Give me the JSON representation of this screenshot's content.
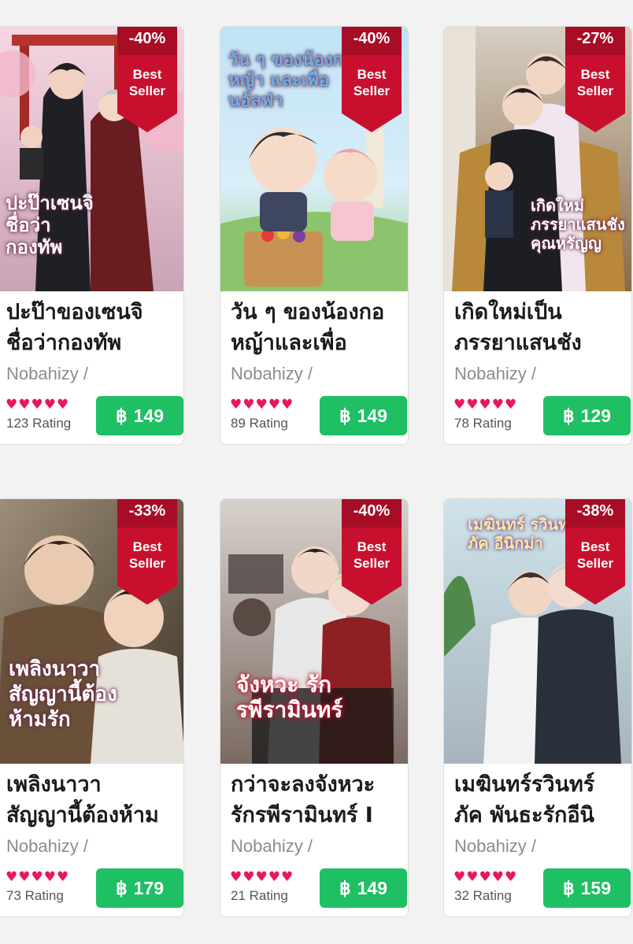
{
  "products": [
    {
      "title": "ปะป๊าของเซนจิ ชื่อว่ากองทัพ",
      "title_line1": "ปะป๊าของเซนจิ",
      "title_line2": "ชื่อว่ากองทัพ",
      "author": "Nobahizy /",
      "discount": "-40%",
      "badge": "Best Seller",
      "badge_line1": "Best",
      "badge_line2": "Seller",
      "hearts": 5,
      "rating": "123 Rating",
      "currency": "฿",
      "price": "149",
      "cover_text": "ปะป๊าเซนจิ ชื่อว่า กองทัพ"
    },
    {
      "title": "วัน ๆ ของน้องกอหญ้าและเพื่อ",
      "title_line1": "วัน ๆ ของน้องกอ",
      "title_line2": "หญ้าและเพื่อ",
      "author": "Nobahizy /",
      "discount": "-40%",
      "badge": "Best Seller",
      "badge_line1": "Best",
      "badge_line2": "Seller",
      "hearts": 5,
      "rating": "89 Rating",
      "currency": "฿",
      "price": "149",
      "cover_text": "วัน ๆ ของน้องกอหญ้า และเพื่อนอัลฟ่า"
    },
    {
      "title": "เกิดใหม่เป็นภรรยาแสนชัง",
      "title_line1": "เกิดใหม่เป็น",
      "title_line2": "ภรรยาแสนชัง",
      "author": "Nobahizy /",
      "discount": "-27%",
      "badge": "Best Seller",
      "badge_line1": "Best",
      "badge_line2": "Seller",
      "hearts": 5,
      "rating": "78 Rating",
      "currency": "฿",
      "price": "129",
      "cover_text": "เกิดใหม่ ภรรยาแสนชัง คุณหรัญญ"
    },
    {
      "title": "เพลิงนาวา สัญญานี้ต้องห้าม",
      "title_line1": "เพลิงนาวา",
      "title_line2": "สัญญานี้ต้องห้าม",
      "author": "Nobahizy /",
      "discount": "-33%",
      "badge": "Best Seller",
      "badge_line1": "Best",
      "badge_line2": "Seller",
      "hearts": 5,
      "rating": "73 Rating",
      "currency": "฿",
      "price": "179",
      "cover_text": "เพลิงนาวา สัญญานี้ต้องห้ามรัก"
    },
    {
      "title": "กว่าจะลงจังหวะรักรพีรามินทร์ I",
      "title_line1": "กว่าจะลงจังหวะ",
      "title_line2": "รักรพีรามินทร์ I",
      "author": "Nobahizy /",
      "discount": "-40%",
      "badge": "Best Seller",
      "badge_line1": "Best",
      "badge_line2": "Seller",
      "hearts": 5,
      "rating": "21 Rating",
      "currency": "฿",
      "price": "149",
      "cover_text": "จังหวะ รัก รพีรามินทร์"
    },
    {
      "title": "เมฆินทร์รวินทร์ภัค พันธะรักอีนิ",
      "title_line1": "เมฆินทร์รวินทร์",
      "title_line2": "ภัค พันธะรักอีนิ",
      "author": "Nobahizy /",
      "discount": "-38%",
      "badge": "Best Seller",
      "badge_line1": "Best",
      "badge_line2": "Seller",
      "hearts": 5,
      "rating": "32 Rating",
      "currency": "฿",
      "price": "159",
      "cover_text": "เมฆินทร์ รวินทร์ภัค อีนิกม่า"
    }
  ],
  "colors": {
    "ribbon": "#c8102e",
    "price_button": "#1fbf63",
    "heart": "#e8175d",
    "author": "#8c8c8c"
  },
  "icons": {
    "rating": "heart-icon",
    "currency": "baht-sign"
  }
}
